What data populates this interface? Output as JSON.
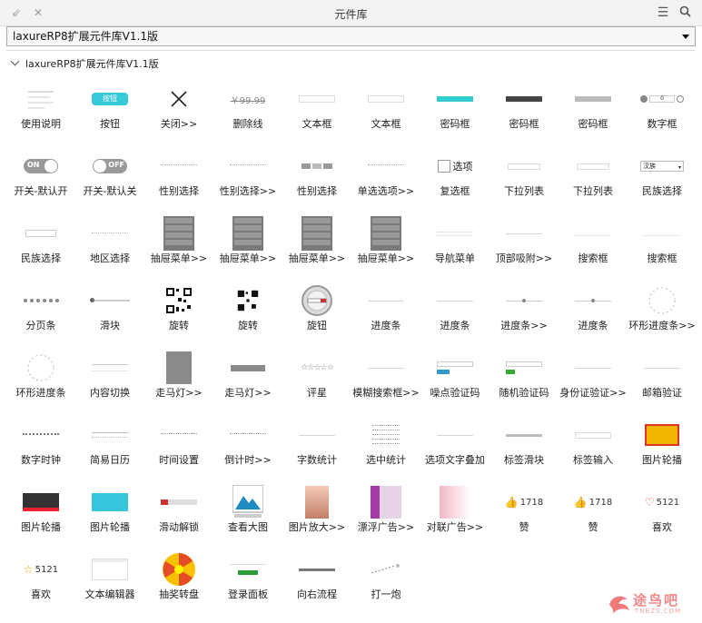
{
  "window": {
    "title": "元件库"
  },
  "library_select": {
    "value": "laxureRP8扩展元件库V1.1版"
  },
  "group": {
    "title": "laxureRP8扩展元件库V1.1版"
  },
  "watermark": {
    "text": "途鸟吧",
    "sub": "TNBZS.COM"
  },
  "items": [
    {
      "label": "使用说明",
      "icon": "doc"
    },
    {
      "label": "按钮",
      "icon": "button",
      "text": "按钮"
    },
    {
      "label": "关闭>>",
      "icon": "close"
    },
    {
      "label": "删除线",
      "icon": "strike",
      "text": "￥99.99"
    },
    {
      "label": "文本框",
      "icon": "textbox"
    },
    {
      "label": "文本框",
      "icon": "textbox"
    },
    {
      "label": "密码框",
      "icon": "password-teal"
    },
    {
      "label": "密码框",
      "icon": "password-dark"
    },
    {
      "label": "密码框",
      "icon": "password-gray"
    },
    {
      "label": "数字框",
      "icon": "stepper",
      "text": "0"
    },
    {
      "label": "开关-默认开",
      "icon": "toggle-on",
      "text": "ON"
    },
    {
      "label": "开关-默认关",
      "icon": "toggle-off",
      "text": "OFF"
    },
    {
      "label": "性别选择",
      "icon": "radio"
    },
    {
      "label": "性别选择>>",
      "icon": "radio"
    },
    {
      "label": "性别选择",
      "icon": "segmented"
    },
    {
      "label": "单选选项>>",
      "icon": "radio"
    },
    {
      "label": "复选框",
      "icon": "checkbox",
      "text": "选项"
    },
    {
      "label": "下拉列表",
      "icon": "dropdown"
    },
    {
      "label": "下拉列表",
      "icon": "dropdown"
    },
    {
      "label": "民族选择",
      "icon": "dropdown-text",
      "text": "汉族"
    },
    {
      "label": "民族选择",
      "icon": "dropdown-small"
    },
    {
      "label": "地区选择",
      "icon": "region"
    },
    {
      "label": "抽屉菜单>>",
      "icon": "drawer"
    },
    {
      "label": "抽屉菜单>>",
      "icon": "drawer"
    },
    {
      "label": "抽屉菜单>>",
      "icon": "drawer"
    },
    {
      "label": "抽屉菜单>>",
      "icon": "drawer"
    },
    {
      "label": "导航菜单",
      "icon": "nav"
    },
    {
      "label": "顶部吸附>>",
      "icon": "line"
    },
    {
      "label": "搜索框",
      "icon": "search"
    },
    {
      "label": "搜索框",
      "icon": "search"
    },
    {
      "label": "分页条",
      "icon": "pagination"
    },
    {
      "label": "滑块",
      "icon": "slider"
    },
    {
      "label": "旋转",
      "icon": "qr"
    },
    {
      "label": "旋转",
      "icon": "qr-small"
    },
    {
      "label": "旋钮",
      "icon": "knob"
    },
    {
      "label": "进度条",
      "icon": "line"
    },
    {
      "label": "进度条",
      "icon": "line"
    },
    {
      "label": "进度条>>",
      "icon": "line-dot"
    },
    {
      "label": "进度条",
      "icon": "line-dot"
    },
    {
      "label": "环形进度条>>",
      "icon": "ring"
    },
    {
      "label": "环形进度条",
      "icon": "ring"
    },
    {
      "label": "内容切换",
      "icon": "tabs"
    },
    {
      "label": "走马灯>>",
      "icon": "gray-box"
    },
    {
      "label": "走马灯>>",
      "icon": "gray-bar"
    },
    {
      "label": "评星",
      "icon": "stars",
      "text": "☆☆☆☆☆"
    },
    {
      "label": "模糊搜索框>>",
      "icon": "line"
    },
    {
      "label": "噪点验证码",
      "icon": "captcha"
    },
    {
      "label": "随机验证码",
      "icon": "captcha-green"
    },
    {
      "label": "身份证验证>>",
      "icon": "line"
    },
    {
      "label": "邮箱验证",
      "icon": "line"
    },
    {
      "label": "数字时钟",
      "icon": "clock"
    },
    {
      "label": "简易日历",
      "icon": "calendar"
    },
    {
      "label": "时间设置",
      "icon": "time"
    },
    {
      "label": "倒计时>>",
      "icon": "time"
    },
    {
      "label": "字数统计",
      "icon": "line"
    },
    {
      "label": "选中统计",
      "icon": "checklist"
    },
    {
      "label": "选项文字叠加",
      "icon": "line"
    },
    {
      "label": "标签滑块",
      "icon": "tags"
    },
    {
      "label": "标签输入",
      "icon": "tag-input"
    },
    {
      "label": "图片轮播",
      "icon": "banner-yellow"
    },
    {
      "label": "图片轮播",
      "icon": "banner-dark"
    },
    {
      "label": "图片轮播",
      "icon": "banner-cyan"
    },
    {
      "label": "滑动解锁",
      "icon": "unlock"
    },
    {
      "label": "查看大图",
      "icon": "image"
    },
    {
      "label": "图片放大>>",
      "icon": "photo"
    },
    {
      "label": "漂浮广告>>",
      "icon": "float-ad"
    },
    {
      "label": "对联广告>>",
      "icon": "couplet"
    },
    {
      "label": "赞",
      "icon": "like",
      "text": "1718"
    },
    {
      "label": "赞",
      "icon": "like",
      "text": "1718"
    },
    {
      "label": "喜欢",
      "icon": "heart",
      "text": "5121"
    },
    {
      "label": "喜欢",
      "icon": "star-count",
      "text": "5121"
    },
    {
      "label": "文本编辑器",
      "icon": "editor"
    },
    {
      "label": "抽奖转盘",
      "icon": "wheel"
    },
    {
      "label": "登录面板",
      "icon": "login"
    },
    {
      "label": "向右流程",
      "icon": "flow"
    },
    {
      "label": "打一炮",
      "icon": "cannon"
    }
  ]
}
